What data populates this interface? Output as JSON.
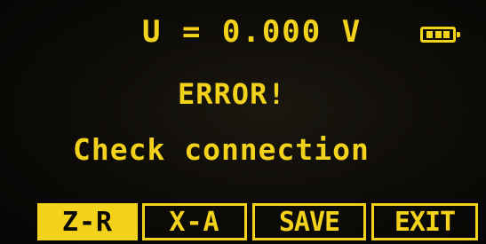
{
  "colors": {
    "lcd_foreground": "#f2d21b",
    "background": "#0b0a06"
  },
  "header": {
    "voltage_readout": "U = 0.000 V",
    "battery_icon": "battery-icon"
  },
  "status": {
    "title": "ERROR!",
    "message": "Check connection"
  },
  "softkeys": [
    {
      "label": "Z-R",
      "active": true
    },
    {
      "label": "X-A",
      "active": false
    },
    {
      "label": "SAVE",
      "active": false
    },
    {
      "label": "EXIT",
      "active": false
    }
  ]
}
